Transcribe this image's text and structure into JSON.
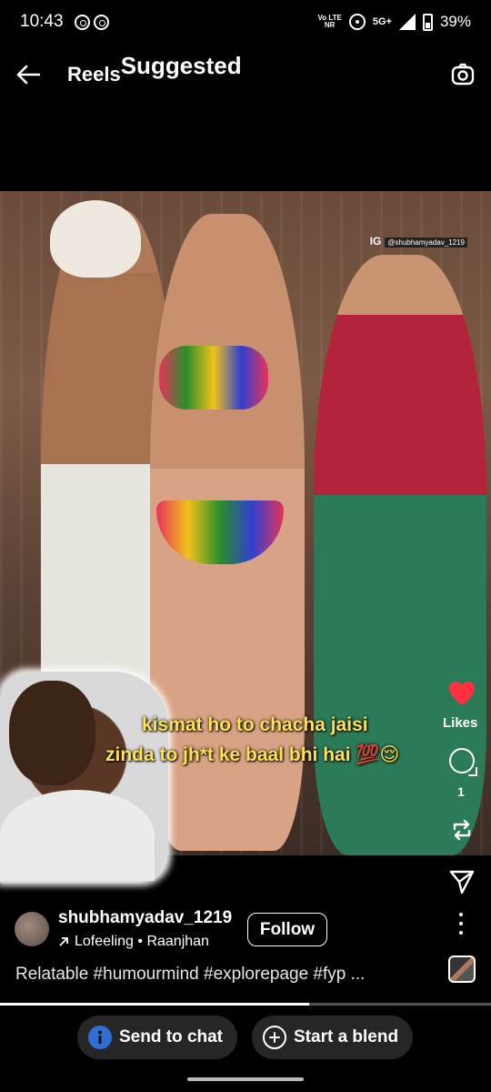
{
  "status_bar": {
    "time": "10:43",
    "net_top": "Vo LTE",
    "net_bottom": "NR",
    "net_5g": "5G+",
    "battery": "39%"
  },
  "header": {
    "title": "Reels",
    "subtitle": "Suggested"
  },
  "video": {
    "watermark_ig": "IG",
    "watermark_handle": "@shubhamyadav_1219",
    "caption_line1": "kismat ho to chacha jaisi",
    "caption_line2": "zinda to jh*t ke baal bhi hai 💯😌"
  },
  "actions": {
    "likes_label": "Likes",
    "comment_count": "1",
    "like_color": "#ff3040"
  },
  "author": {
    "username": "shubhamyadav_1219",
    "audio": "Lofeeling • Raanjhan",
    "follow_label": "Follow"
  },
  "description": "Relatable #humourmind #explorepage #fyp ...",
  "progress": {
    "fraction": 0.63
  },
  "bottom": {
    "send_label": "Send to chat",
    "blend_label": "Start a blend"
  },
  "icons": [
    "back-arrow-icon",
    "camera-icon",
    "heart-icon",
    "comment-icon",
    "repost-icon",
    "share-icon",
    "more-icon",
    "info-icon",
    "blend-icon"
  ]
}
